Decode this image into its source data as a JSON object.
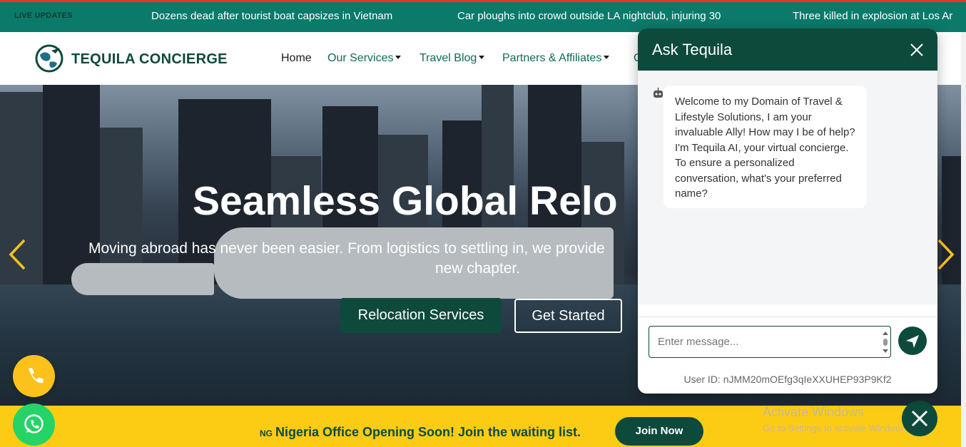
{
  "ticker": {
    "label": "LIVE UPDATES",
    "items": [
      "Dozens dead after tourist boat capsizes in Vietnam",
      "Car ploughs into crowd outside LA nightclub, injuring 30",
      "Three killed in explosion at Los Ar"
    ]
  },
  "nav": {
    "brand": "TEQUILA CONCIERGE",
    "items": [
      {
        "label": "Home",
        "dropdown": false
      },
      {
        "label": "Our Services",
        "dropdown": true
      },
      {
        "label": "Travel Blog",
        "dropdown": true
      },
      {
        "label": "Partners & Affiliates",
        "dropdown": true
      },
      {
        "label": "C",
        "dropdown": false
      }
    ]
  },
  "hero": {
    "title": "Seamless Global Relo",
    "subtitle": "Moving abroad has never been easier. From logistics to settling in, we provide",
    "subtitle2": "new chapter.",
    "primary_button": "Relocation Services",
    "secondary_button": "Get Started"
  },
  "banner": {
    "flag_code": "NG",
    "text": "Nigeria Office Opening Soon! Join the waiting list.",
    "button": "Join Now"
  },
  "chat": {
    "title": "Ask Tequila",
    "bot_message": "Welcome to my Domain of Travel & Lifestyle Solutions, I am your invaluable Ally! How may I be of help? I'm Tequila AI, your virtual concierge. To ensure a personalized conversation, what's your preferred name?",
    "input_placeholder": "Enter message...",
    "user_id": "User ID: nJMM20mOEfg3qIeXXUHEP93P9Kf2"
  },
  "windows_watermark": {
    "line1": "Activate Windows",
    "line2": "Go to Settings to activate Windows."
  },
  "colors": {
    "brand_green": "#0d4a3c",
    "ticker_green": "#0b7a6a",
    "banner_yellow": "#fccc15",
    "whatsapp_green": "#25d366",
    "phone_yellow": "#fcc21b"
  },
  "icons": [
    "globe-logo-icon",
    "caret-down-icon",
    "chevron-left-icon",
    "chevron-right-icon",
    "phone-icon",
    "whatsapp-icon",
    "close-icon",
    "robot-icon",
    "send-icon"
  ]
}
